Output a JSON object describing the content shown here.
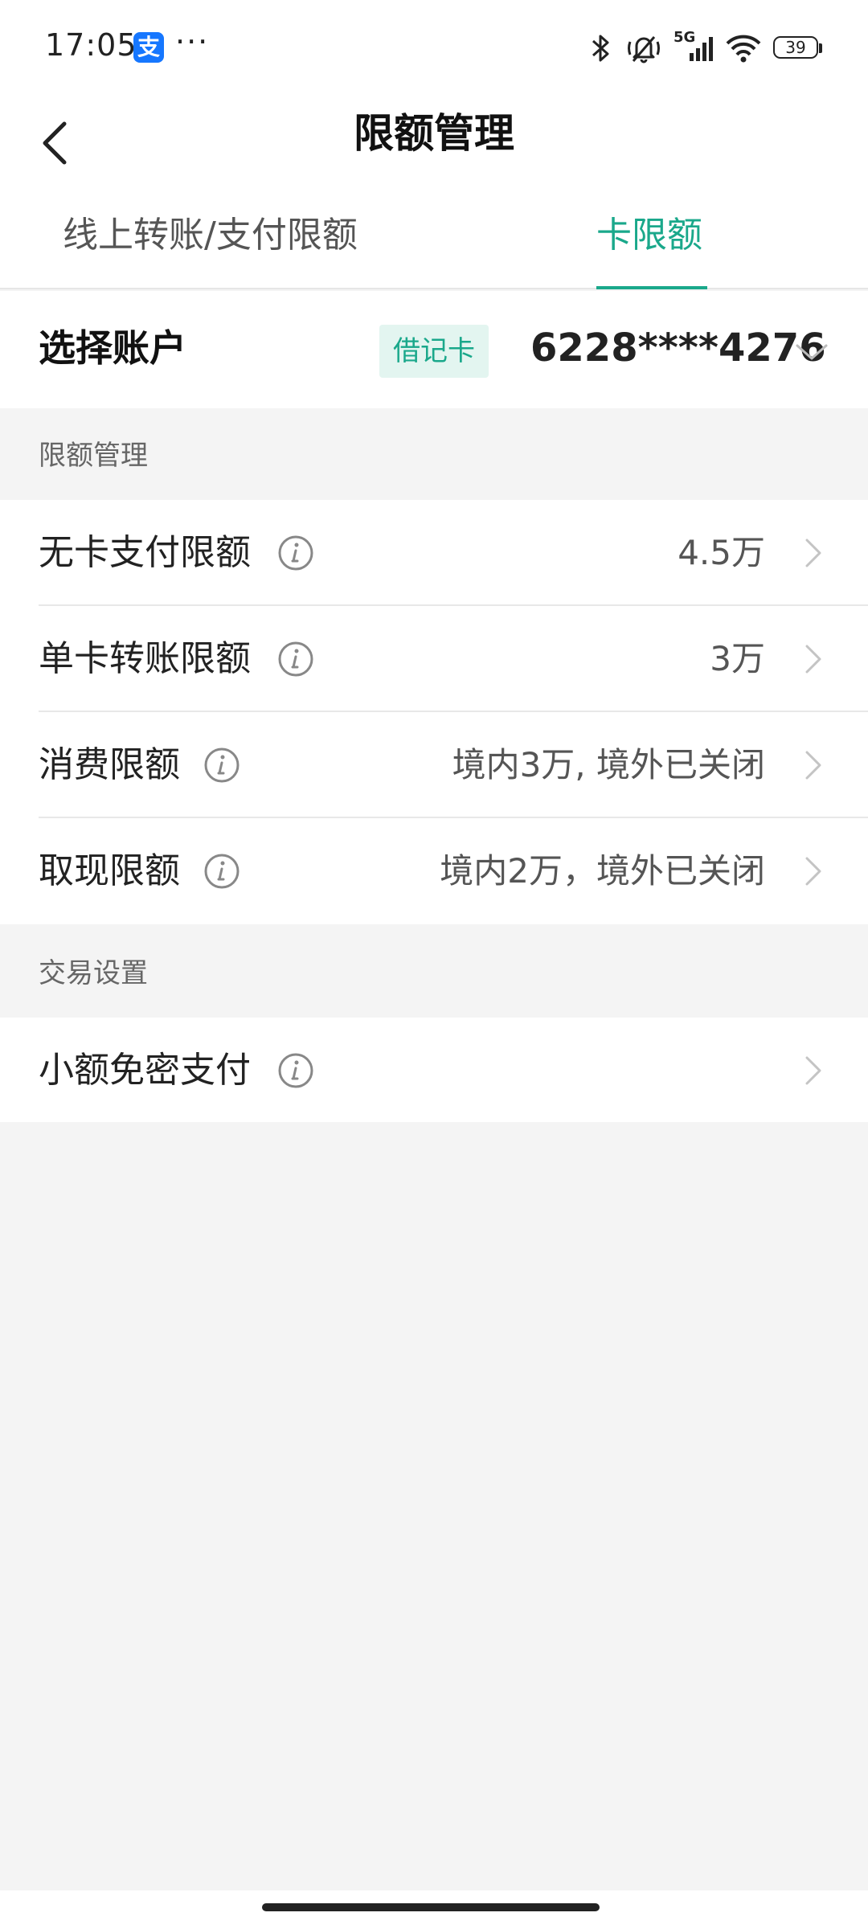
{
  "status_bar": {
    "time": "17:05",
    "app_badge": "支",
    "more": "···",
    "network": "5G",
    "battery": "39"
  },
  "header": {
    "title": "限额管理"
  },
  "tabs": [
    {
      "label": "线上转账/支付限额",
      "active": false
    },
    {
      "label": "卡限额",
      "active": true
    }
  ],
  "account": {
    "label": "选择账户",
    "card_type": "借记卡",
    "card_number": "6228****4276"
  },
  "sections": {
    "limits": {
      "title": "限额管理",
      "items": [
        {
          "label": "无卡支付限额",
          "value": "4.5万"
        },
        {
          "label": "单卡转账限额",
          "value": "3万"
        },
        {
          "label": "消费限额",
          "value": "境内3万, 境外已关闭"
        },
        {
          "label": "取现限额",
          "value": "境内2万，境外已关闭"
        }
      ]
    },
    "trade": {
      "title": "交易设置",
      "items": [
        {
          "label": "小额免密支付",
          "value": ""
        }
      ]
    }
  },
  "colors": {
    "accent": "#1aa88b",
    "background": "#f4f4f4"
  },
  "icons": {
    "back": "back-arrow-icon",
    "info": "info-icon",
    "chevron_right": "chevron-right-icon",
    "chevron_down": "chevron-down-icon"
  }
}
